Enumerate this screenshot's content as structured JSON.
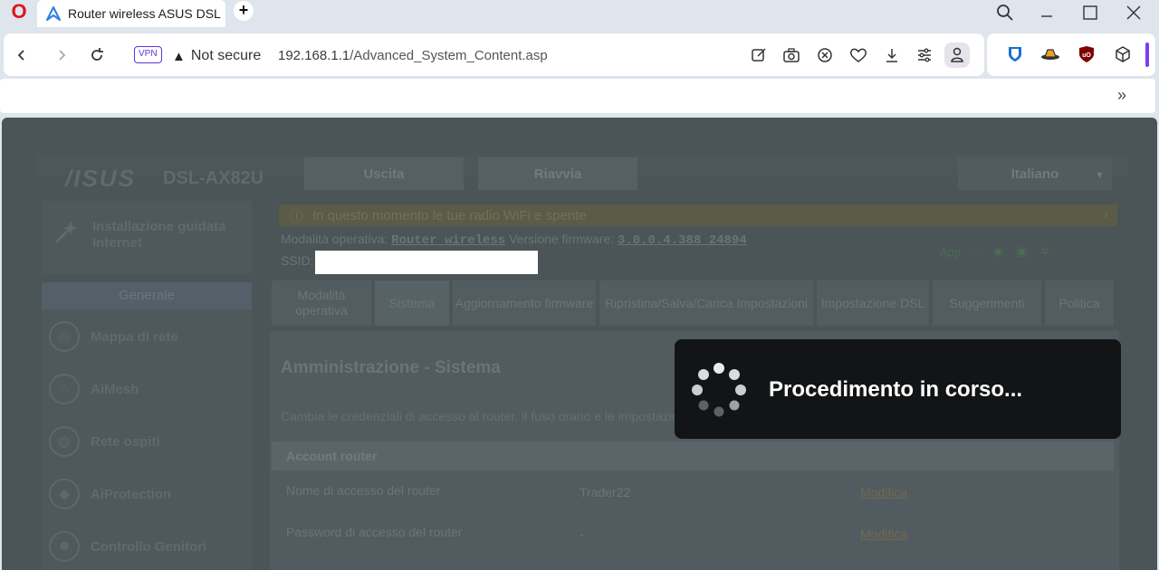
{
  "browser": {
    "tab_title": "Router wireless ASUS DSL",
    "new_tab_symbol": "+",
    "vpn_label": "VPN",
    "security_label": "Not secure",
    "url_host": "192.168.1.1",
    "url_path": "/Advanced_System_Content.asp",
    "bookmarks_more": "»"
  },
  "router": {
    "brand": "/ISUS",
    "model": "DSL-AX82U",
    "top_buttons": [
      "Uscita",
      "Riavvia"
    ],
    "language": "Italiano",
    "notice": "In questo momento le tue radio WiFi e spente",
    "notice_arrow": "›",
    "mode_label": "Modalità operativa:",
    "mode_value": "Router wireless",
    "firmware_label": "Versione firmware:",
    "firmware_value": "3.0.0.4.388_24894",
    "ssid_label": "SSID:",
    "status_app": "App",
    "sidebar": {
      "wizard": "Installazione guidata Internet",
      "section": "Generale",
      "items": [
        "Mappa di rete",
        "AiMesh",
        "Rete ospiti",
        "AiProtection",
        "Controllo Genitori"
      ]
    },
    "tabs": [
      "Modalità operativa",
      "Sistema",
      "Aggiornamento firmware",
      "Ripristina/Salva/Carica Impostazioni",
      "Impostazione DSL",
      "Suggerimenti",
      "Politica"
    ],
    "page_title": "Amministrazione - Sistema",
    "page_desc": "Cambia le credenziali di accesso al router, il fuso orario e le impostazioni del server NTP",
    "section_title": "Account router",
    "rows": [
      {
        "key": "Nome di accesso del router",
        "value": "Trader22",
        "link": "Modifica"
      },
      {
        "key": "Password di accesso del router",
        "value": "-",
        "link": "Modifica"
      }
    ]
  },
  "overlay": {
    "message": "Procedimento in corso..."
  }
}
